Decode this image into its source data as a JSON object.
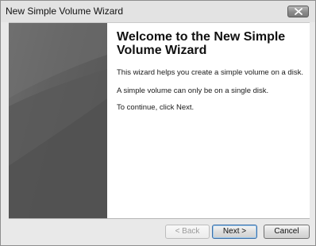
{
  "window": {
    "title": "New Simple Volume Wizard",
    "close_icon": "close-icon"
  },
  "wizard": {
    "heading": "Welcome to the New Simple Volume Wizard",
    "paragraphs": [
      "This wizard helps you create a simple volume on a disk.",
      "A simple volume can only be on a single disk.",
      "To continue, click Next."
    ]
  },
  "buttons": {
    "back": "< Back",
    "next": "Next >",
    "cancel": "Cancel"
  },
  "state": {
    "back_enabled": false,
    "default_button": "next"
  }
}
